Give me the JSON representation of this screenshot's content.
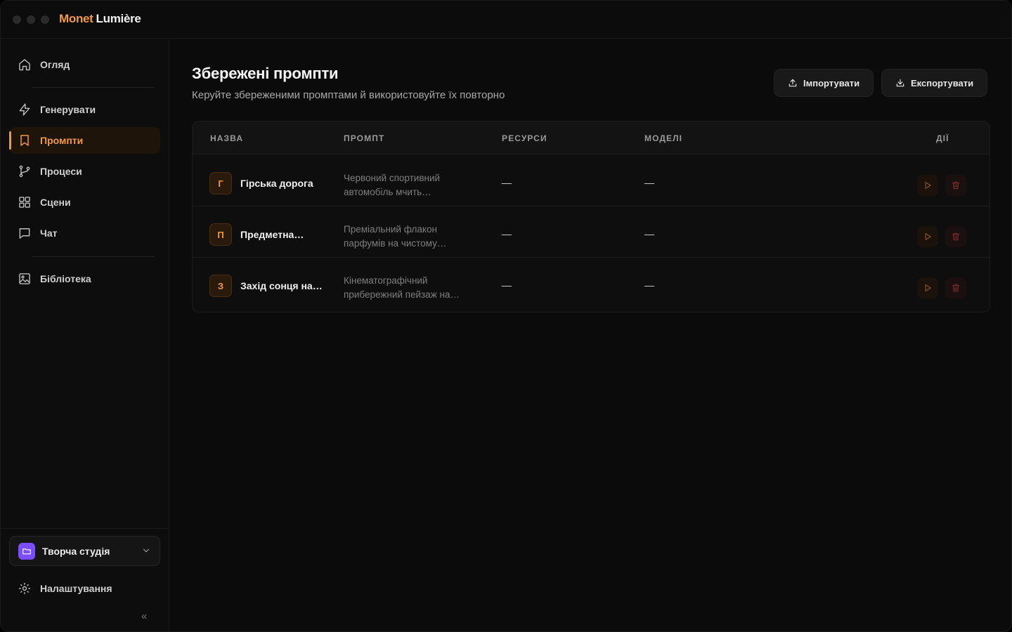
{
  "app": {
    "brand_primary": "Monet",
    "brand_secondary": "Lumière",
    "accent": "#f29a3b"
  },
  "sidebar": {
    "items": [
      {
        "label": "Огляд",
        "icon": "home-icon"
      },
      {
        "label": "Генерувати",
        "icon": "bolt-icon"
      },
      {
        "label": "Промпти",
        "icon": "bookmark-icon",
        "active": true
      },
      {
        "label": "Процеси",
        "icon": "branch-icon"
      },
      {
        "label": "Сцени",
        "icon": "grid-icon"
      },
      {
        "label": "Чат",
        "icon": "chat-icon"
      },
      {
        "label": "Бібліотека",
        "icon": "image-icon"
      }
    ],
    "workspace": {
      "label": "Творча студія",
      "icon": "folder-icon",
      "color": "#7c4dff"
    },
    "settings_label": "Налаштування",
    "collapse_symbol": "«"
  },
  "page": {
    "title": "Збережені промпти",
    "subtitle": "Керуйте збереженими промптами й використовуйте їх повторно",
    "import_label": "Імпортувати",
    "export_label": "Експортувати"
  },
  "table": {
    "columns": [
      "НАЗВА",
      "ПРОМПТ",
      "РЕСУРСИ",
      "МОДЕЛІ",
      "ДІЇ"
    ],
    "rows": [
      {
        "initial": "Г",
        "name": "Гірська дорога",
        "prompt": "Червоний спортивний автомобіль мчить…",
        "resources": "—",
        "models": "—"
      },
      {
        "initial": "П",
        "name": "Предметна…",
        "prompt": "Преміальний флакон парфумів на чистому…",
        "resources": "—",
        "models": "—"
      },
      {
        "initial": "З",
        "name": "Захід сонця на…",
        "prompt": "Кінематографічний прибережний пейзаж на…",
        "resources": "—",
        "models": "—"
      }
    ]
  }
}
